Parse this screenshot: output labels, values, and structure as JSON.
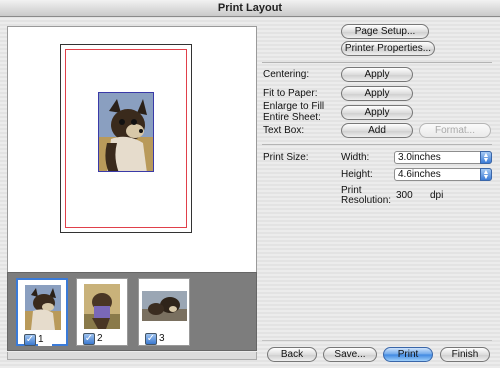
{
  "window": {
    "title": "Print Layout"
  },
  "thumbnails": [
    {
      "number": "1",
      "checked": true,
      "selected": true
    },
    {
      "number": "2",
      "checked": true,
      "selected": false
    },
    {
      "number": "3",
      "checked": true,
      "selected": false
    }
  ],
  "buttons": {
    "page_setup": "Page Setup...",
    "printer_properties": "Printer Properties...",
    "centering_apply": "Apply",
    "fit_apply": "Apply",
    "enlarge_apply": "Apply",
    "text_box_add": "Add",
    "format": "Format...",
    "back": "Back",
    "save": "Save...",
    "print": "Print",
    "finish": "Finish"
  },
  "labels": {
    "centering": "Centering:",
    "fit_to_paper": "Fit to Paper:",
    "enlarge_line1": "Enlarge to Fill",
    "enlarge_line2": "Entire Sheet:",
    "text_box": "Text Box:",
    "print_size": "Print Size:",
    "width": "Width:",
    "height": "Height:",
    "print_resolution_line1": "Print",
    "print_resolution_line2": "Resolution:",
    "resolution_value": "300",
    "resolution_unit": "dpi"
  },
  "fields": {
    "width_value": "3.0inches",
    "height_value": "4.6inches"
  },
  "colors": {
    "accent": "#3b7bd8",
    "margin_line": "#e0404a",
    "default_button": "#3d86e0"
  }
}
